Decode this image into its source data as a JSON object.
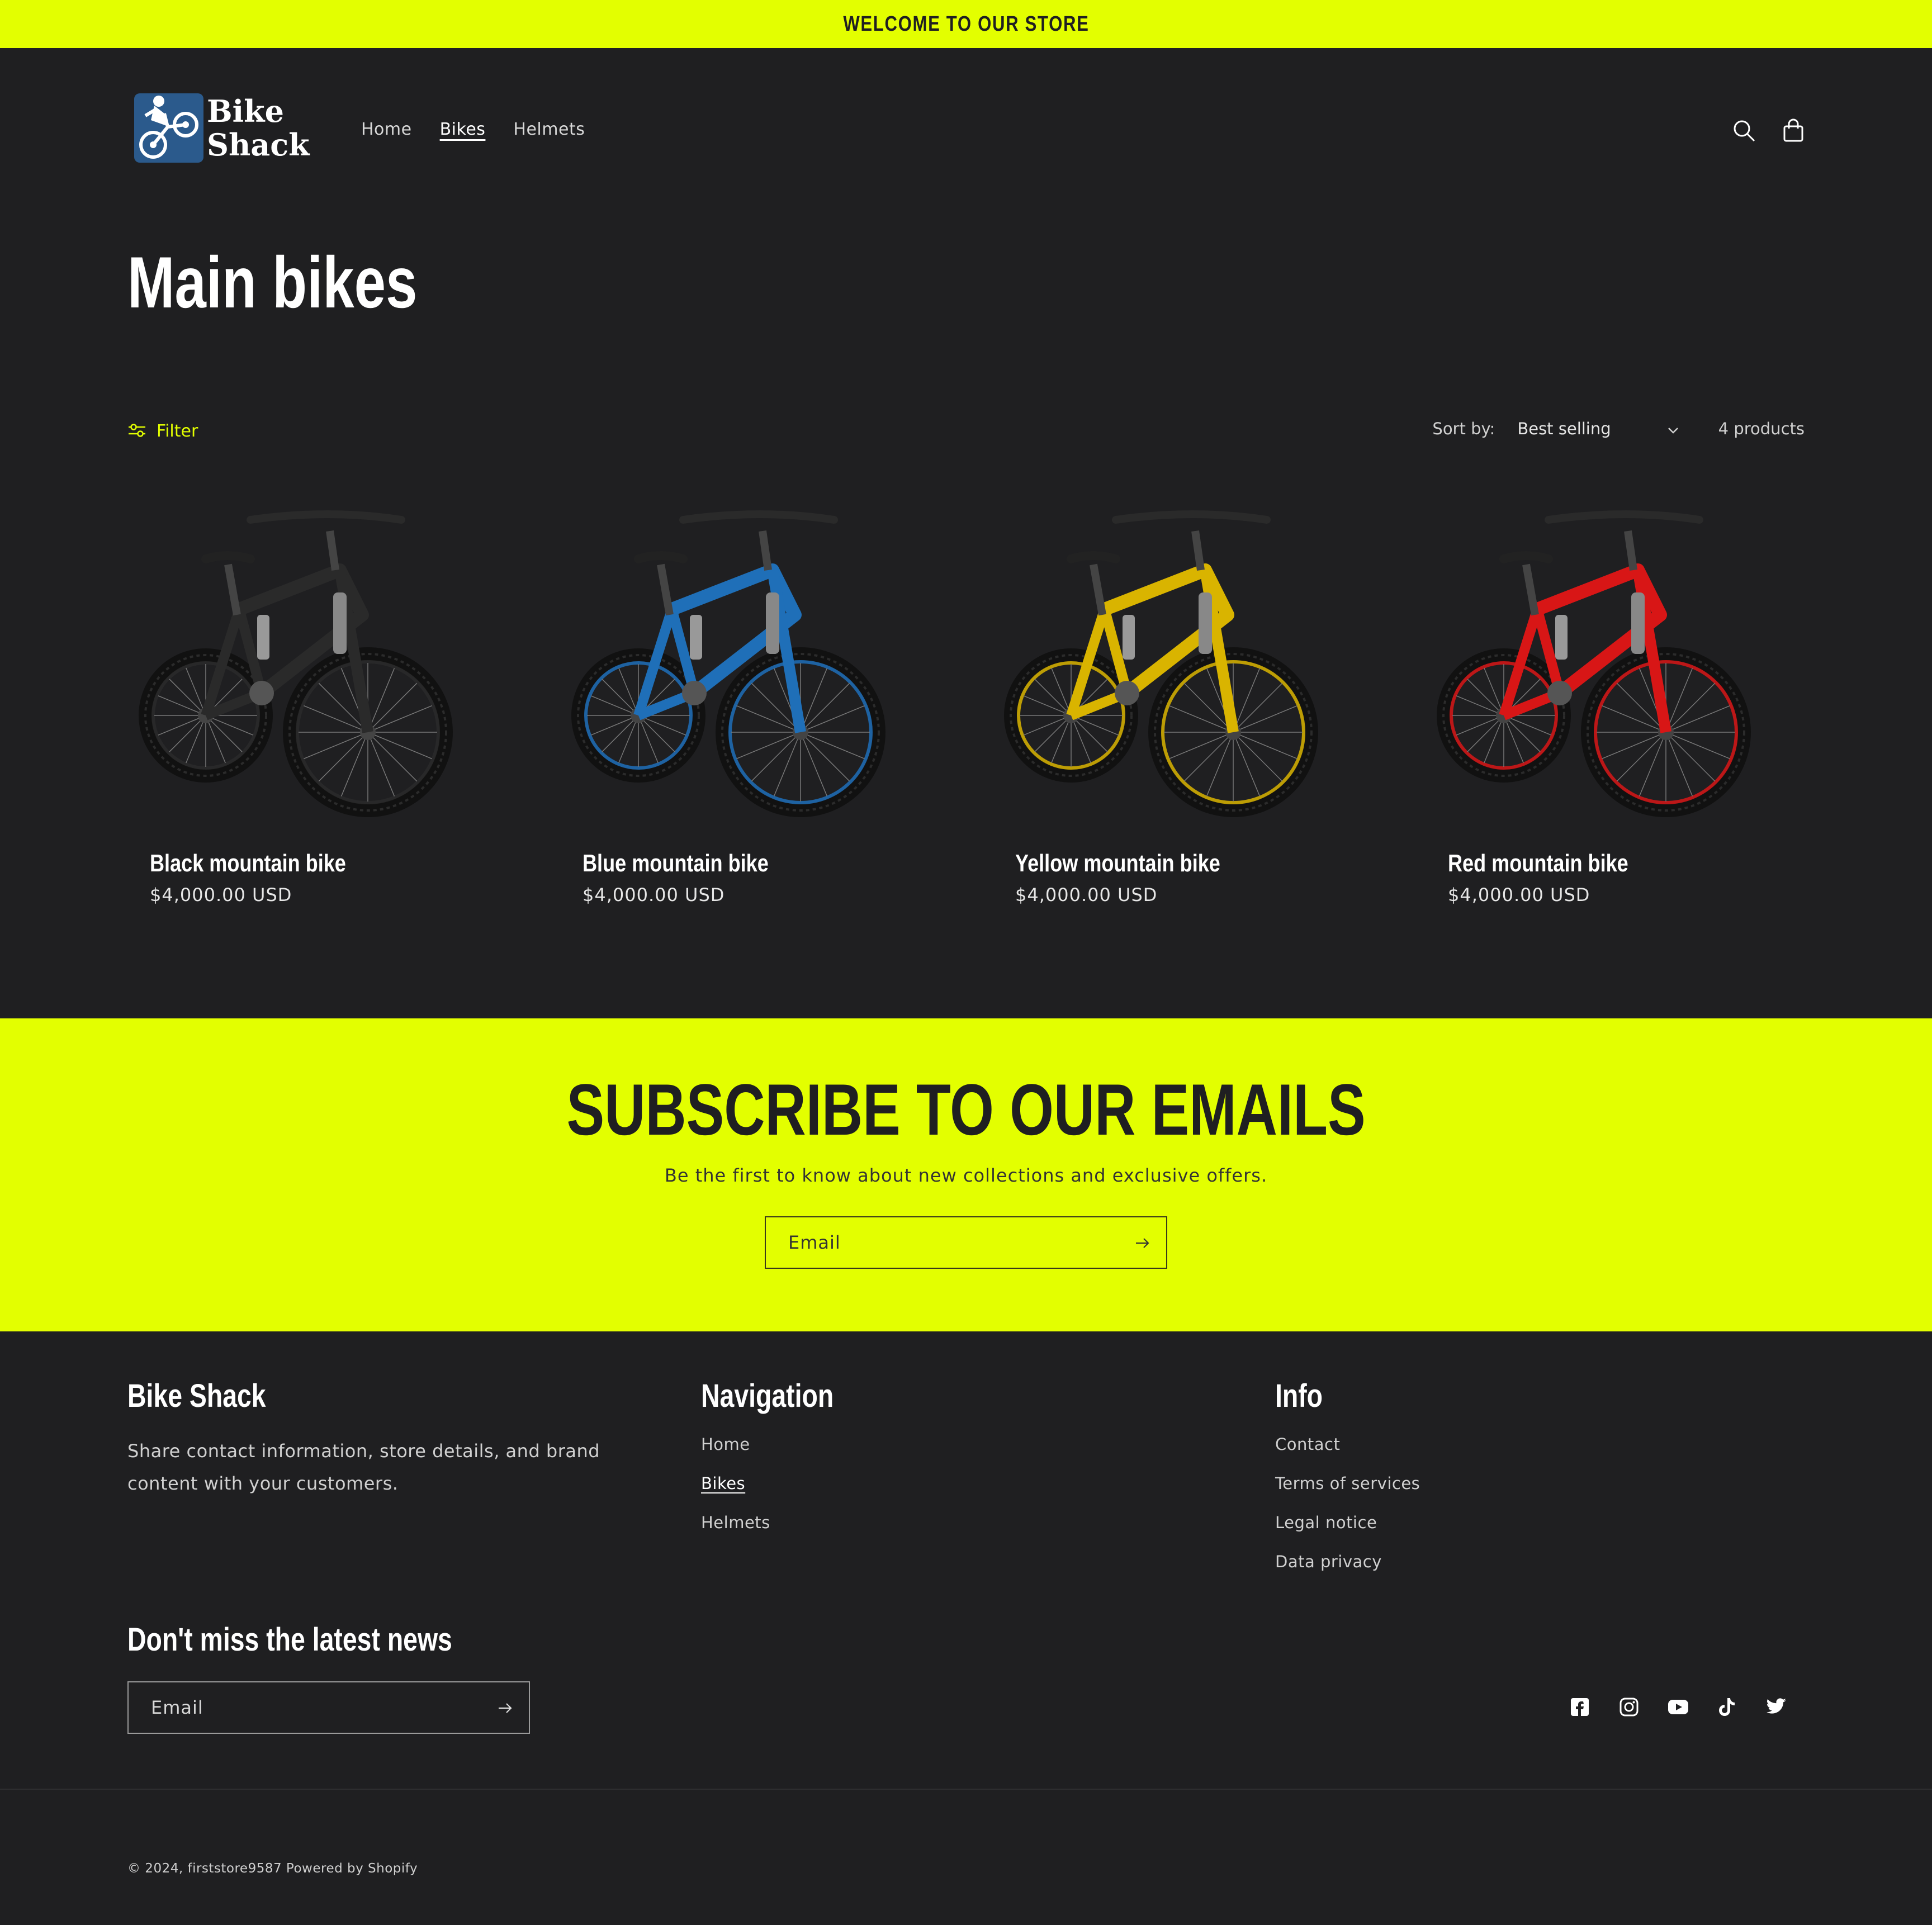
{
  "announcement": {
    "text": "WELCOME TO OUR STORE"
  },
  "colors": {
    "accent": "#e3ff00",
    "background": "#1f1f21",
    "text": "#ffffff"
  },
  "header": {
    "logo": {
      "line1": "Bike",
      "line2": "Shack"
    },
    "nav": [
      {
        "label": "Home",
        "active": false
      },
      {
        "label": "Bikes",
        "active": true
      },
      {
        "label": "Helmets",
        "active": false
      }
    ],
    "icons": [
      "search-icon",
      "cart-icon"
    ]
  },
  "collection": {
    "title": "Main bikes",
    "filter_label": "Filter",
    "sort_label": "Sort by:",
    "sort_value": "Best selling",
    "product_count": "4 products"
  },
  "products": [
    {
      "title": "Black mountain bike",
      "price": "$4,000.00 USD",
      "color": "#2a2a2a"
    },
    {
      "title": "Blue mountain bike",
      "price": "$4,000.00 USD",
      "color": "#1f6fb8"
    },
    {
      "title": "Yellow mountain bike",
      "price": "$4,000.00 USD",
      "color": "#d9b400"
    },
    {
      "title": "Red mountain bike",
      "price": "$4,000.00 USD",
      "color": "#d81616"
    }
  ],
  "subscribe": {
    "heading": "SUBSCRIBE TO OUR EMAILS",
    "text": "Be the first to know about new collections and exclusive offers.",
    "placeholder": "Email"
  },
  "footer": {
    "brand": {
      "heading": "Bike Shack",
      "text": "Share contact information, store details, and brand content with your customers."
    },
    "navigation": {
      "heading": "Navigation",
      "links": [
        {
          "label": "Home",
          "active": false
        },
        {
          "label": "Bikes",
          "active": true
        },
        {
          "label": "Helmets",
          "active": false
        }
      ]
    },
    "info": {
      "heading": "Info",
      "links": [
        "Contact",
        "Terms of services",
        "Legal notice",
        "Data privacy"
      ]
    },
    "newsletter": {
      "heading": "Don't miss the latest news",
      "placeholder": "Email"
    },
    "socials": [
      "facebook-icon",
      "instagram-icon",
      "youtube-icon",
      "tiktok-icon",
      "twitter-icon"
    ],
    "copyright": "© 2024, firststore9587 Powered by Shopify"
  }
}
